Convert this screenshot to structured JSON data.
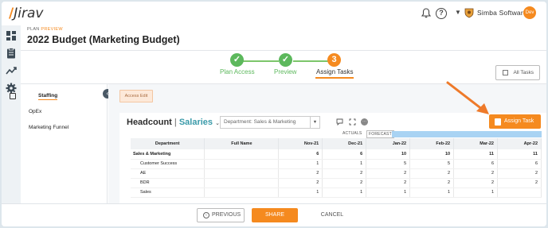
{
  "app": {
    "logo_text": "Jirav",
    "logo_accent": "/"
  },
  "header": {
    "org_name": "Simba Software",
    "avatar_label": "Dev",
    "help_glyph": "?"
  },
  "breadcrumb": {
    "prefix": "PLAN",
    "mode": "PREVIEW"
  },
  "page_title": "2022 Budget (Marketing Budget)",
  "steps": [
    {
      "label": "Plan Access",
      "state": "done",
      "glyph": "✓"
    },
    {
      "label": "Preview",
      "state": "done",
      "glyph": "✓"
    },
    {
      "label": "Assign Tasks",
      "state": "active",
      "glyph": "3"
    }
  ],
  "all_tasks_label": "All Tasks",
  "sidebar": {
    "items": [
      {
        "label": "Staffing",
        "active": true
      },
      {
        "label": "OpEx",
        "active": false
      },
      {
        "label": "Marketing Funnel",
        "active": false
      }
    ]
  },
  "access_edit_label": "Access Edit",
  "panel": {
    "title_main": "Headcount",
    "title_sep": "|",
    "title_sub": "Salaries",
    "dept_filter": "Department: Sales & Marketing",
    "tag_actuals": "ACTUALS",
    "tag_forecast": "FORECAST",
    "more_glyph": "···"
  },
  "assign_task_label": "Assign Task",
  "table": {
    "columns": [
      "Department",
      "Full Name",
      "Nov-21",
      "Dec-21",
      "Jan-22",
      "Feb-22",
      "Mar-22",
      "Apr-22"
    ],
    "rows": [
      {
        "dept": "Sales & Marketing",
        "name": "",
        "values": [
          "6",
          "6",
          "10",
          "10",
          "11",
          "11"
        ],
        "group": true
      },
      {
        "dept": "Customer Success",
        "name": "",
        "values": [
          "1",
          "1",
          "5",
          "5",
          "6",
          "6"
        ],
        "group": false
      },
      {
        "dept": "AE",
        "name": "",
        "values": [
          "2",
          "2",
          "2",
          "2",
          "2",
          "2"
        ],
        "group": false
      },
      {
        "dept": "BDR",
        "name": "",
        "values": [
          "2",
          "2",
          "2",
          "2",
          "2",
          "2"
        ],
        "group": false
      },
      {
        "dept": "Sales",
        "name": "",
        "values": [
          "1",
          "1",
          "1",
          "1",
          "1",
          ""
        ],
        "group": false
      }
    ]
  },
  "footer": {
    "previous_label": "PREVIOUS",
    "share_label": "SHARE",
    "cancel_label": "CANCEL"
  },
  "colors": {
    "accent": "#f58a1f",
    "success": "#5cb85c",
    "teal": "#3a9aa9",
    "forecast_band": "#a9d3f3"
  }
}
